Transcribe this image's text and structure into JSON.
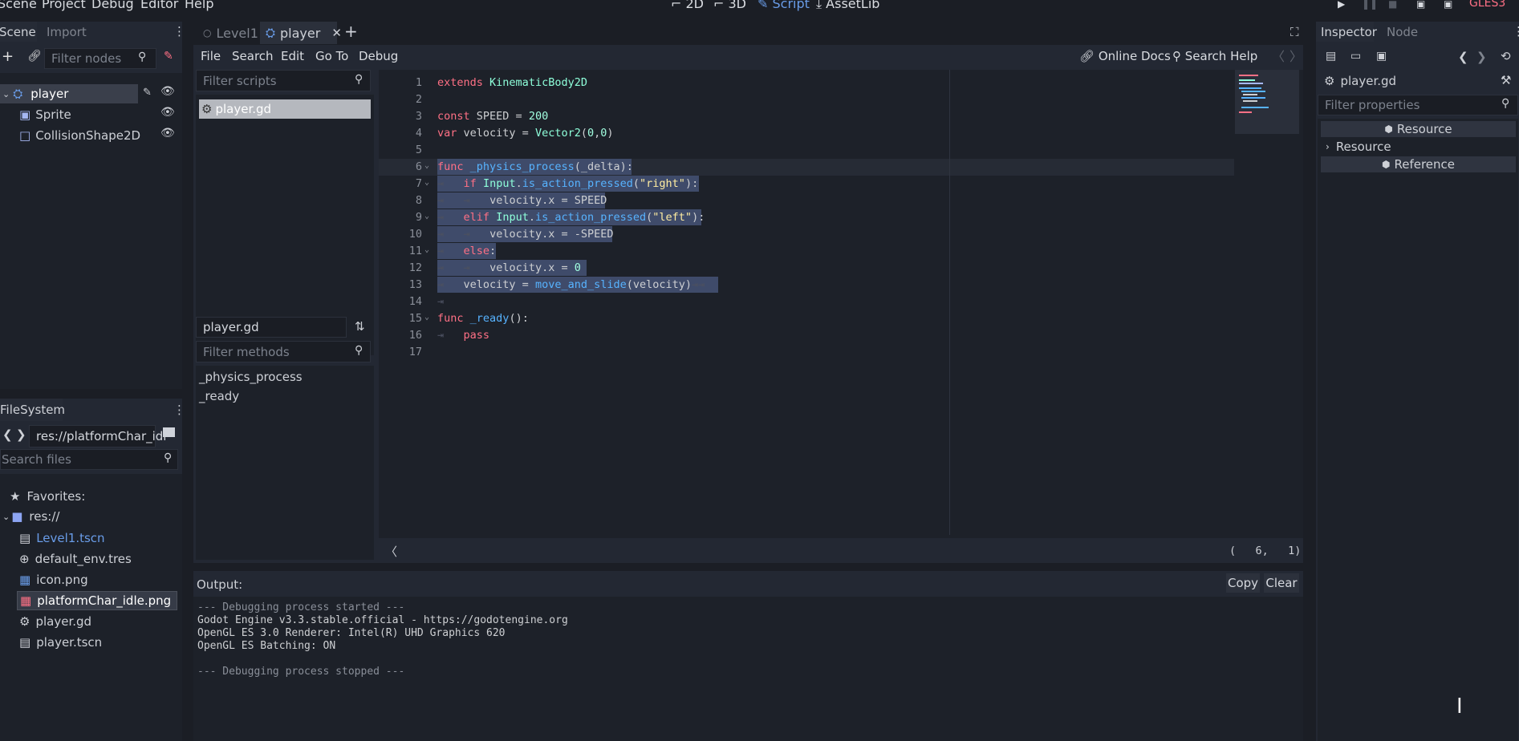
{
  "top_menu": [
    "Scene",
    "Project",
    "Debug",
    "Editor",
    "Help"
  ],
  "workspaces": [
    {
      "label": "2D",
      "icon": "2d-icon"
    },
    {
      "label": "3D",
      "icon": "3d-icon"
    },
    {
      "label": "Script",
      "icon": "script-icon"
    },
    {
      "label": "AssetLib",
      "icon": "assetlib-icon"
    }
  ],
  "renderer": "GLES3",
  "scene_dock": {
    "tabs": [
      "Scene",
      "Import"
    ],
    "filter_placeholder": "Filter nodes",
    "nodes": [
      "player",
      "Sprite",
      "CollisionShape2D"
    ]
  },
  "filesystem_dock": {
    "title": "FileSystem",
    "path": "res://platformChar_idl",
    "search_placeholder": "Search files",
    "favorites_label": "Favorites:",
    "root": "res://",
    "files": [
      "Level1.tscn",
      "default_env.tres",
      "icon.png",
      "platformChar_idle.png",
      "player.gd",
      "player.tscn"
    ]
  },
  "editor_tabs": [
    "Level1",
    "player"
  ],
  "script_menu": [
    "File",
    "Search",
    "Edit",
    "Go To",
    "Debug"
  ],
  "online_docs": "Online Docs",
  "search_help": "Search Help",
  "scripts_panel": {
    "filter_placeholder": "Filter scripts",
    "scripts": [
      "player.gd"
    ],
    "current_script": "player.gd",
    "methods_placeholder": "Filter methods",
    "methods": [
      "_physics_process",
      "_ready"
    ]
  },
  "code_line_numbers": [
    "1",
    "2",
    "3",
    "4",
    "5",
    "6",
    "7",
    "8",
    "9",
    "10",
    "11",
    "12",
    "13",
    "14",
    "15",
    "16",
    "17"
  ],
  "cursor_position": "(   6,   1)",
  "output": {
    "label": "Output:",
    "copy": "Copy",
    "clear": "Clear",
    "lines": [
      "--- Debugging process started ---",
      "Godot Engine v3.3.stable.official - https://godotengine.org",
      "OpenGL ES 3.0 Renderer: Intel(R) UHD Graphics 620",
      "OpenGL ES Batching: ON",
      "",
      "--- Debugging process stopped ---"
    ]
  },
  "inspector": {
    "tabs": [
      "Inspector",
      "Node"
    ],
    "object": "player.gd",
    "filter_placeholder": "Filter properties",
    "sections": [
      "Resource",
      "Resource",
      "Reference"
    ]
  },
  "colors": {
    "keyword": "#ff7085",
    "type": "#8effda",
    "function": "#57b3ff",
    "string": "#ffeda1",
    "accent": "#699ce8"
  }
}
